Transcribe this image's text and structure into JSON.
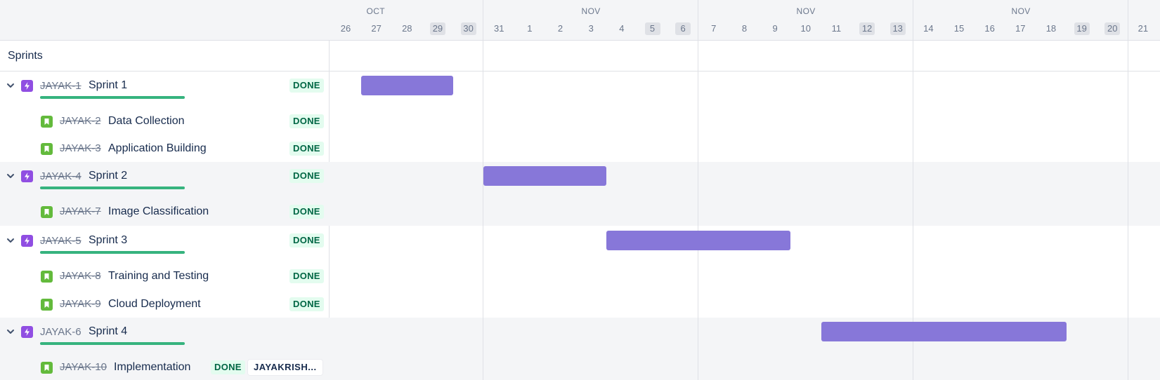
{
  "panel": {
    "header_title": "Sprints"
  },
  "timeline": {
    "months": [
      "OCT",
      "NOV",
      "NOV",
      "NOV"
    ],
    "days": [
      {
        "label": "26",
        "weekend": false
      },
      {
        "label": "27",
        "weekend": false
      },
      {
        "label": "28",
        "weekend": false
      },
      {
        "label": "29",
        "weekend": true
      },
      {
        "label": "30",
        "weekend": true
      },
      {
        "label": "31",
        "weekend": false
      },
      {
        "label": "1",
        "weekend": false
      },
      {
        "label": "2",
        "weekend": false
      },
      {
        "label": "3",
        "weekend": false
      },
      {
        "label": "4",
        "weekend": false
      },
      {
        "label": "5",
        "weekend": true
      },
      {
        "label": "6",
        "weekend": true
      },
      {
        "label": "7",
        "weekend": false
      },
      {
        "label": "8",
        "weekend": false
      },
      {
        "label": "9",
        "weekend": false
      },
      {
        "label": "10",
        "weekend": false
      },
      {
        "label": "11",
        "weekend": false
      },
      {
        "label": "12",
        "weekend": true
      },
      {
        "label": "13",
        "weekend": true
      },
      {
        "label": "14",
        "weekend": false
      },
      {
        "label": "15",
        "weekend": false
      },
      {
        "label": "16",
        "weekend": false
      },
      {
        "label": "17",
        "weekend": false
      },
      {
        "label": "18",
        "weekend": false
      },
      {
        "label": "19",
        "weekend": true
      },
      {
        "label": "20",
        "weekend": true
      },
      {
        "label": "21",
        "weekend": false
      }
    ]
  },
  "items": [
    {
      "type": "epic",
      "key": "JAYAK-1",
      "title": "Sprint 1",
      "status": "DONE",
      "key_struck": true,
      "progress": 1.0,
      "bar": {
        "start": "Oct 27",
        "end": "Oct 29"
      }
    },
    {
      "type": "story",
      "key": "JAYAK-2",
      "title": "Data Collection",
      "status": "DONE",
      "key_struck": true
    },
    {
      "type": "story",
      "key": "JAYAK-3",
      "title": "Application Building",
      "status": "DONE",
      "key_struck": true
    },
    {
      "type": "epic",
      "key": "JAYAK-4",
      "title": "Sprint 2",
      "status": "DONE",
      "key_struck": true,
      "progress": 1.0,
      "bar": {
        "start": "Oct 31",
        "end": "Nov 3"
      }
    },
    {
      "type": "story",
      "key": "JAYAK-7",
      "title": "Image Classification",
      "status": "DONE",
      "key_struck": true
    },
    {
      "type": "epic",
      "key": "JAYAK-5",
      "title": "Sprint 3",
      "status": "DONE",
      "key_struck": true,
      "progress": 1.0,
      "bar": {
        "start": "Nov 4",
        "end": "Nov 9"
      }
    },
    {
      "type": "story",
      "key": "JAYAK-8",
      "title": "Training and Testing",
      "status": "DONE",
      "key_struck": true
    },
    {
      "type": "story",
      "key": "JAYAK-9",
      "title": "Cloud Deployment",
      "status": "DONE",
      "key_struck": true
    },
    {
      "type": "epic",
      "key": "JAYAK-6",
      "title": "Sprint 4",
      "status": "",
      "key_struck": false,
      "progress": 1.0,
      "bar": {
        "start": "Nov 11",
        "end": "Nov 18"
      }
    },
    {
      "type": "story",
      "key": "JAYAK-10",
      "title": "Implementation",
      "status": "DONE",
      "key_struck": true,
      "assignee": "JAYAKRISH..."
    }
  ],
  "colors": {
    "bar": "#8777d9",
    "epic_icon": "#904ee2",
    "story_icon": "#63ba3c",
    "progress": "#36b37e",
    "done_text": "#006644",
    "done_bg": "#e3fcef",
    "shaded_row": "#f4f5f7"
  },
  "icons": {
    "expand": "chevron-down-icon",
    "epic": "lightning-icon",
    "story": "bookmark-icon"
  }
}
